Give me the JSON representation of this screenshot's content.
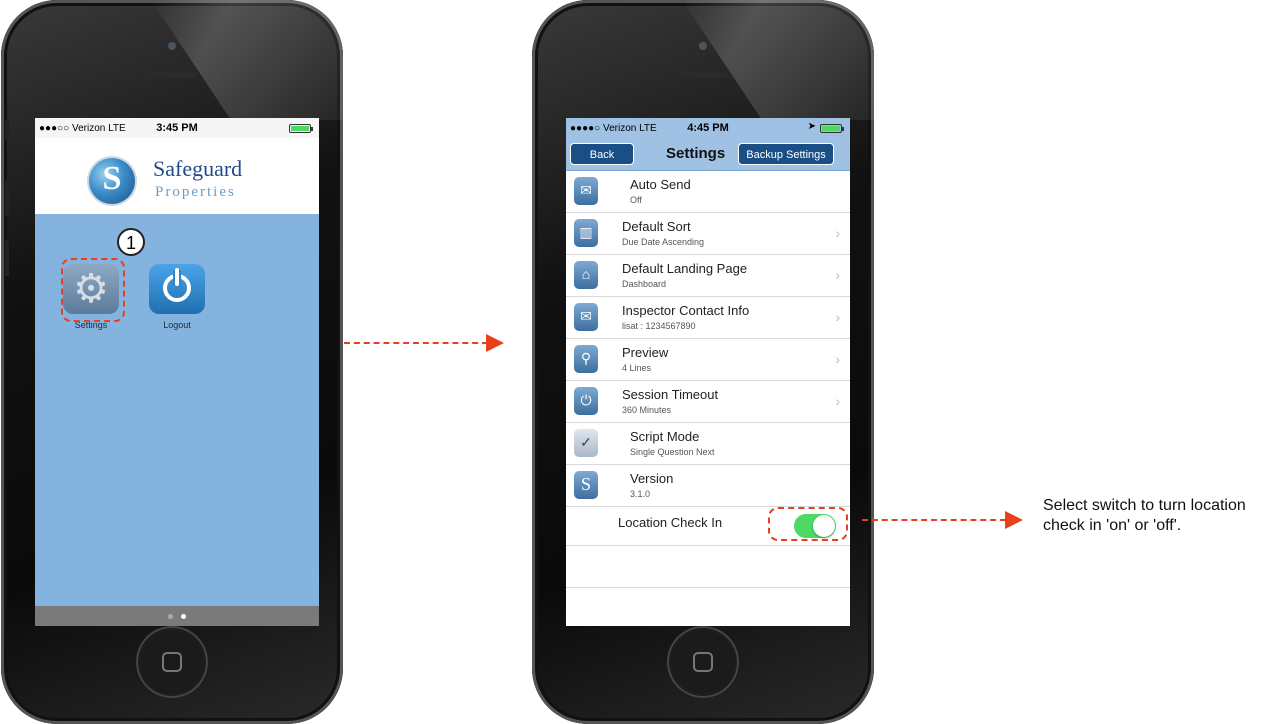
{
  "left_phone": {
    "status": {
      "carrier": "●●●○○ Verizon  LTE",
      "time": "3:45 PM"
    },
    "brand": {
      "line1": "Safeguard",
      "line2": "Properties",
      "logo_letter": "S"
    },
    "apps": [
      {
        "label": "Settings",
        "icon": "gear-icon"
      },
      {
        "label": "Logout",
        "icon": "power-icon"
      }
    ],
    "step_badge": "1"
  },
  "right_phone": {
    "status": {
      "carrier": "●●●●○ Verizon  LTE",
      "time": "4:45 PM"
    },
    "nav": {
      "back": "Back",
      "title": "Settings",
      "backup": "Backup Settings"
    },
    "rows": [
      {
        "title": "Auto Send",
        "sub": "Off",
        "icon": "mail-icon",
        "chevron": false
      },
      {
        "title": "Default Sort",
        "sub": "Due Date Ascending",
        "icon": "bars-icon",
        "chevron": true
      },
      {
        "title": "Default Landing Page",
        "sub": "Dashboard",
        "icon": "home-icon",
        "chevron": true
      },
      {
        "title": "Inspector Contact Info",
        "sub": "lisat : 1234567890",
        "icon": "envelope-icon",
        "chevron": true
      },
      {
        "title": "Preview",
        "sub": "4 Lines",
        "icon": "magnifier-icon",
        "chevron": true
      },
      {
        "title": "Session Timeout",
        "sub": "360 Minutes",
        "icon": "power-icon",
        "chevron": true
      },
      {
        "title": "Script Mode",
        "sub": "Single Question Next",
        "icon": "checklist-icon",
        "chevron": false
      },
      {
        "title": "Version",
        "sub": "3.1.0",
        "icon": "logo-icon",
        "chevron": false
      }
    ],
    "location": {
      "label": "Location Check In",
      "on": true
    }
  },
  "annotation": {
    "text": "Select switch to turn location check in 'on' or 'off'."
  },
  "colors": {
    "accent": "#e8401c",
    "nav": "#1a4f86",
    "toggle_on": "#4cd964",
    "desk": "#85b3df"
  }
}
